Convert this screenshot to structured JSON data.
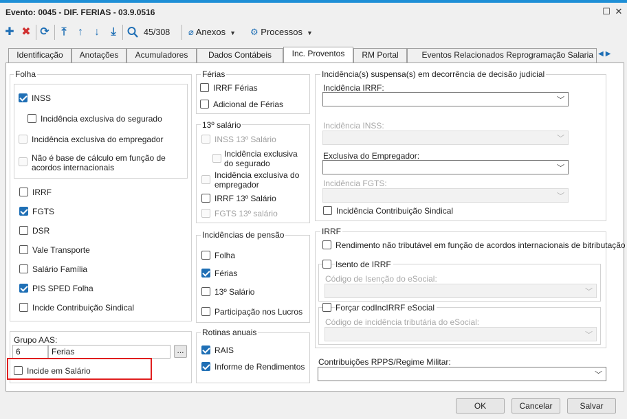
{
  "window": {
    "title": "Evento: 0045 - DIF. FERIAS - 03.9.0516"
  },
  "toolbar": {
    "record_position": "45/308",
    "annexes_label": "Anexos",
    "processes_label": "Processos"
  },
  "tabs": [
    {
      "label": "Identificação"
    },
    {
      "label": "Anotações"
    },
    {
      "label": "Acumuladores"
    },
    {
      "label": "Dados Contábeis"
    },
    {
      "label": "Inc. Proventos",
      "active": true
    },
    {
      "label": "RM Portal"
    },
    {
      "label": "Eventos Relacionados Reprogramação Salaria"
    }
  ],
  "folha": {
    "title": "Folha",
    "inss": "INSS",
    "inc_segurado": "Incidência exclusiva do segurado",
    "inc_empregador": "Incidência exclusiva do empregador",
    "nao_base": "Não é base de cálculo em função de acordos internacionais",
    "irrf": "IRRF",
    "fgts": "FGTS",
    "dsr": "DSR",
    "vale_transporte": "Vale Transporte",
    "salario_familia": "Salário Família",
    "pis_sped": "PIS SPED Folha",
    "incide_sindical": "Incide Contribuição Sindical"
  },
  "grupo_aas": {
    "label": "Grupo AAS:",
    "code": "6",
    "name": "Ferias",
    "lookup_label": "..."
  },
  "incide_salario": "Incide em Salário",
  "ferias": {
    "title": "Férias",
    "irrf_ferias": "IRRF Férias",
    "adicional": "Adicional de Férias"
  },
  "decimo": {
    "title": "13º salário",
    "inss_13": "INSS 13º Salário",
    "inc_segurado": "Incidência exclusiva do segurado",
    "inc_empregador": "Incidência exclusiva do empregador",
    "irrf_13": "IRRF 13º Salário",
    "fgts_13": "FGTS 13º salário"
  },
  "pensao": {
    "title": "Incidências de pensão",
    "folha": "Folha",
    "ferias": "Férias",
    "decimo": "13º Salário",
    "participacao": "Participação nos Lucros"
  },
  "rotinas": {
    "title": "Rotinas anuais",
    "rais": "RAIS",
    "informe": "Informe de Rendimentos"
  },
  "suspensas": {
    "title": "Incidência(s) suspensa(s) em decorrência de decisão judicial",
    "irrf_label": "Incidência IRRF:",
    "inss_label": "Incidência INSS:",
    "empregador_label": "Exclusiva do Empregador:",
    "fgts_label": "Incidência FGTS:",
    "sindical": "Incidência Contribuição Sindical"
  },
  "irrf_group": {
    "title": "IRRF",
    "rendimento": "Rendimento não tributável em função de acordos internacionais de bitributação",
    "isento": "Isento de IRRF",
    "codigo_isencao": "Código de Isenção do eSocial:",
    "forcar": "Forçar codIncIRRF eSocial",
    "codigo_incidencia": "Código de incidência tributária do eSocial:"
  },
  "rpps": {
    "label": "Contribuições RPPS/Regime Militar:"
  },
  "footer": {
    "ok": "OK",
    "cancel": "Cancelar",
    "save": "Salvar"
  },
  "colors": {
    "accent": "#1e8fd6",
    "toolbar_icon": "#1f6fb5",
    "delete_icon": "#d03030",
    "highlight": "#e01e1e"
  }
}
